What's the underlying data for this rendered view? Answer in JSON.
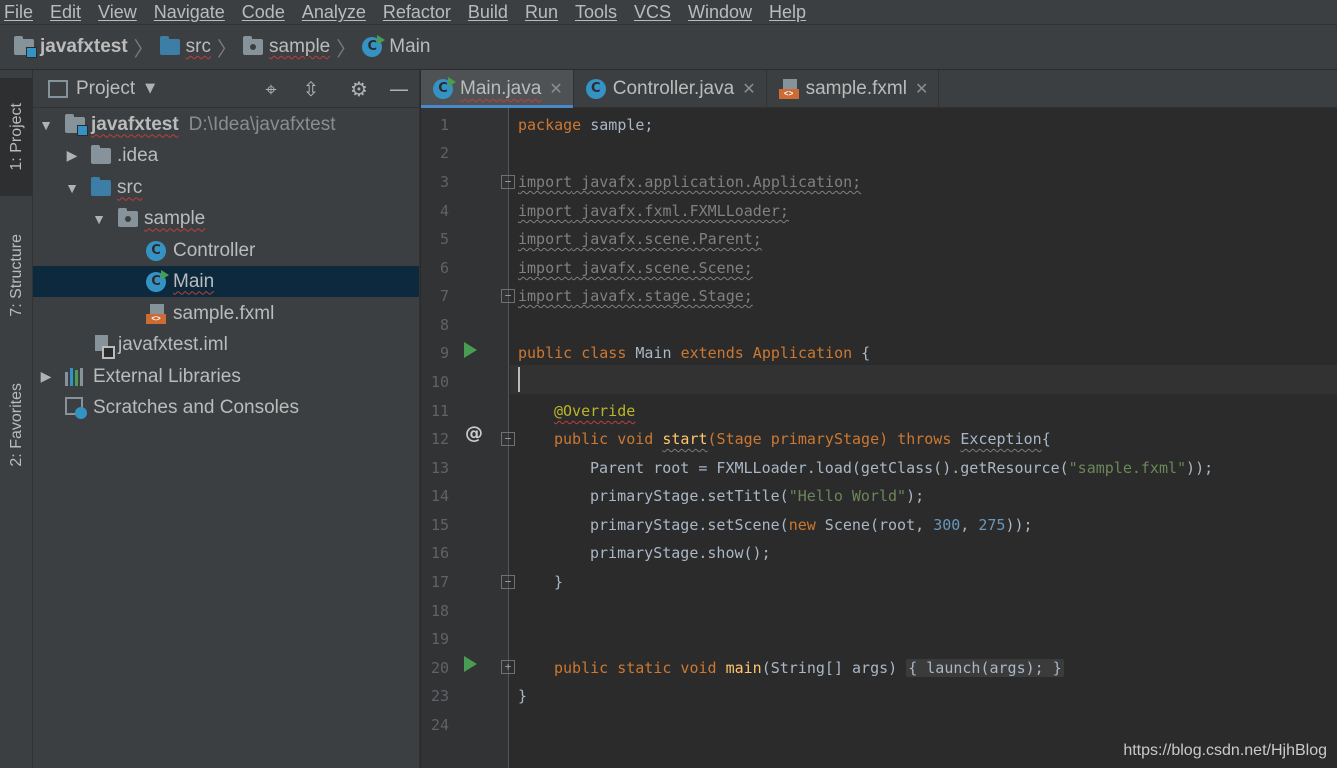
{
  "menu": [
    "File",
    "Edit",
    "View",
    "Navigate",
    "Code",
    "Analyze",
    "Refactor",
    "Build",
    "Run",
    "Tools",
    "VCS",
    "Window",
    "Help"
  ],
  "breadcrumb": [
    "javafxtest",
    "src",
    "sample",
    "Main"
  ],
  "tool_tabs": {
    "project": "1: Project",
    "structure": "7: Structure",
    "favorites": "2: Favorites"
  },
  "project_panel": {
    "title": "Project",
    "tree": [
      {
        "label": "javafxtest",
        "path": "D:\\Idea\\javafxtest",
        "icon": "project-folder-icon",
        "expanded": true
      },
      {
        "label": ".idea",
        "icon": "folder-icon",
        "expanded": false
      },
      {
        "label": "src",
        "icon": "source-folder-icon",
        "expanded": true
      },
      {
        "label": "sample",
        "icon": "package-icon",
        "expanded": true
      },
      {
        "label": "Controller",
        "icon": "class-icon"
      },
      {
        "label": "Main",
        "icon": "runnable-class-icon",
        "selected": true
      },
      {
        "label": "sample.fxml",
        "icon": "fxml-file-icon"
      },
      {
        "label": "javafxtest.iml",
        "icon": "module-file-icon"
      },
      {
        "label": "External Libraries",
        "icon": "libraries-icon",
        "expanded": false
      },
      {
        "label": "Scratches and Consoles",
        "icon": "scratches-icon"
      }
    ]
  },
  "tabs": [
    {
      "label": "Main.java",
      "active": true
    },
    {
      "label": "Controller.java",
      "active": false
    },
    {
      "label": "sample.fxml",
      "active": false
    }
  ],
  "editor": {
    "line_numbers": [
      "1",
      "2",
      "3",
      "4",
      "5",
      "6",
      "7",
      "8",
      "9",
      "10",
      "11",
      "12",
      "13",
      "14",
      "15",
      "16",
      "17",
      "18",
      "19",
      "20",
      "23",
      "24"
    ],
    "code": {
      "l1_kw": "package",
      "l1_rest": " sample;",
      "imp_kw": "import",
      "l3": " javafx.application.Application;",
      "l4": " javafx.fxml.FXMLLoader;",
      "l5": " javafx.scene.Parent;",
      "l6": " javafx.scene.Scene;",
      "l7": " javafx.stage.Stage;",
      "l9_kw": "public class",
      "l9_name": " Main ",
      "l9_ext": "extends",
      "l9_sup": " Application",
      "l9_end": " {",
      "l11": "@Override",
      "l12_kw": "public void",
      "l12_m": "start",
      "l12_p": "(Stage primaryStage) ",
      "l12_th": "throws",
      "l12_ex": "Exception",
      "l12_end": "{",
      "l13_a": "Parent root = FXMLLoader.load(getClass().getResource(",
      "l13_s": "\"sample.fxml\"",
      "l13_e": "));",
      "l14_a": "primaryStage.setTitle(",
      "l14_s": "\"Hello World\"",
      "l14_e": ");",
      "l15_a": "primaryStage.setScene(",
      "l15_new": "new",
      "l15_b": " Scene(root, ",
      "l15_n1": "300",
      "l15_c": ", ",
      "l15_n2": "275",
      "l15_e": "));",
      "l16": "primaryStage.show();",
      "l17": "}",
      "l20_kw": "public static void",
      "l20_m": " main",
      "l20_p": "(String[] args) ",
      "l20_fold": "{ launch(args); }",
      "l23": "}"
    }
  },
  "watermark": "https://blog.csdn.net/HjhBlog"
}
